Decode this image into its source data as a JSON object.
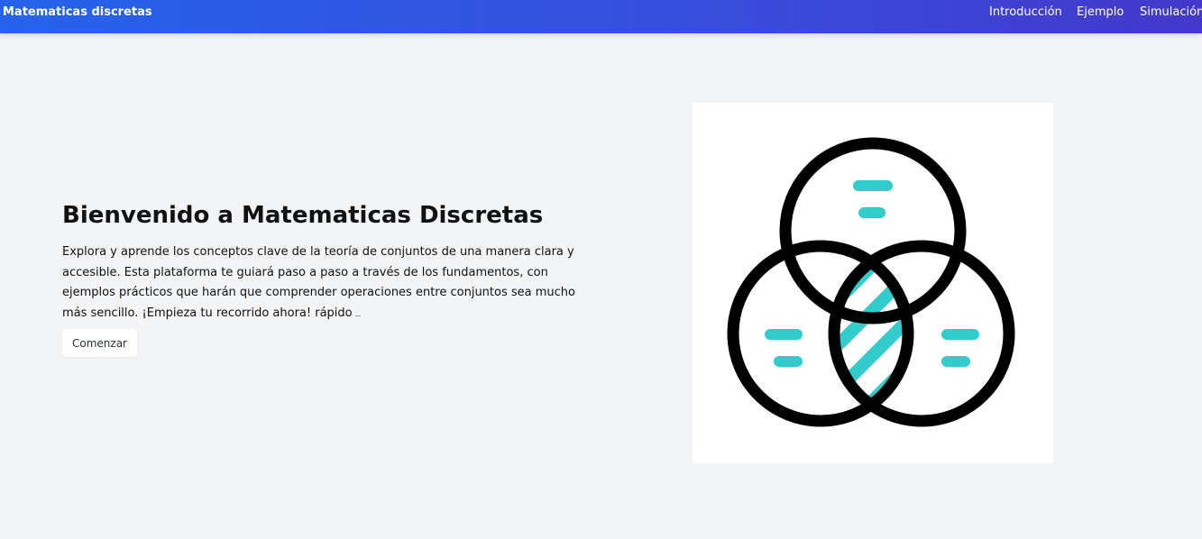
{
  "navbar": {
    "brand": "Matematicas discretas",
    "links": [
      "Introducción",
      "Ejemplo",
      "Simulación"
    ]
  },
  "hero": {
    "title": "Bienvenido a Matematicas Discretas",
    "paragraph": "Explora y aprende los conceptos clave de la teoría de conjuntos de una manera clara y accesible. Esta plataforma te guiará paso a paso a través de los fundamentos, con ejemplos prácticos que harán que comprender operaciones entre conjuntos sea mucho más sencillo. ¡Empieza tu recorrido ahora! rápido",
    "button_label": "Comenzar"
  },
  "illustration": {
    "icon": "venn-diagram-icon",
    "stroke_color": "#000000",
    "accent_color": "#33cccc"
  }
}
